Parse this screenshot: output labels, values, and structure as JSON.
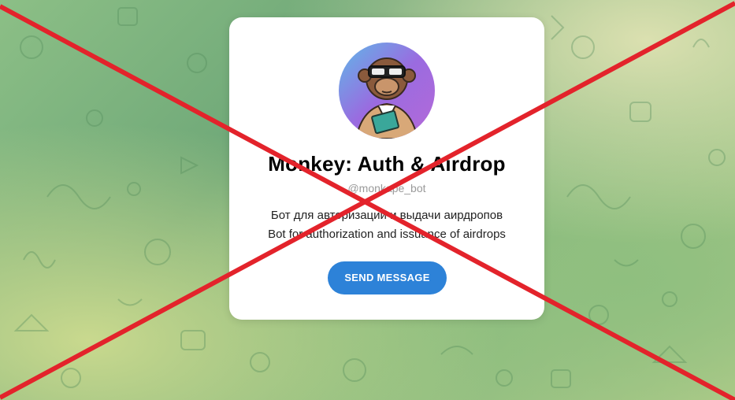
{
  "bot": {
    "name": "Monkey: Auth & Airdrop",
    "username": "@monkape_bot",
    "description_ru": "Бот для авторизации и выдачи аирдропов",
    "description_en": "Bot for authorization and issuance of airdrops",
    "avatar_icon": "monkey-avatar-icon"
  },
  "actions": {
    "send_message_label": "SEND MESSAGE"
  },
  "colors": {
    "button": "#2d82d8",
    "cross": "#e3232b",
    "background_green": "#7fb47e"
  }
}
